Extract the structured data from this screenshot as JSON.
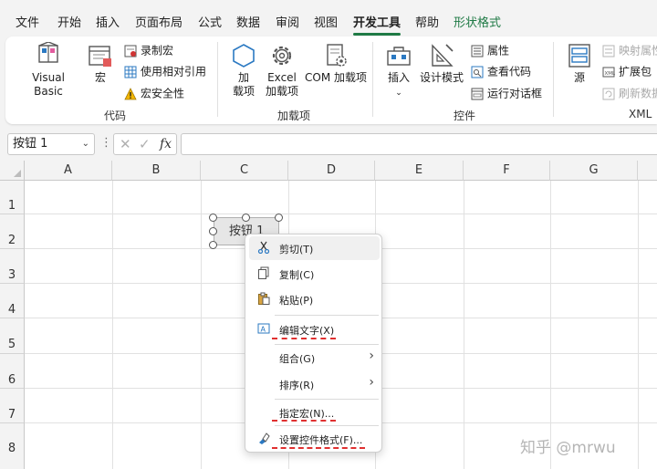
{
  "menubar": {
    "tabs": [
      "文件",
      "开始",
      "插入",
      "页面布局",
      "公式",
      "数据",
      "审阅",
      "视图",
      "开发工具",
      "帮助",
      "形状格式"
    ]
  },
  "ribbon": {
    "code": {
      "label": "代码",
      "visual_basic": "Visual Basic",
      "macros": "宏",
      "record_macro": "录制宏",
      "relative_ref": "使用相对引用",
      "macro_security": "宏安全性"
    },
    "addins": {
      "label": "加载项",
      "addins_line1": "加",
      "addins_line2": "载项",
      "excel_line1": "Excel",
      "excel_line2": "加载项",
      "com_addins": "COM 加载项"
    },
    "controls": {
      "label": "控件",
      "insert": "插入",
      "design_mode": "设计模式",
      "properties": "属性",
      "view_code": "查看代码",
      "run_dialog": "运行对话框"
    },
    "xml": {
      "label": "XML",
      "source": "源",
      "map_properties": "映射属性",
      "expansion_packs": "扩展包",
      "refresh_data": "刷新数据"
    }
  },
  "formula_bar": {
    "name_box": "按钮 1",
    "cancel_symbol": "✕",
    "enter_symbol": "✓",
    "fx_symbol": "fx",
    "content": ""
  },
  "grid": {
    "columns": [
      "A",
      "B",
      "C",
      "D",
      "E",
      "F",
      "G"
    ],
    "rows": [
      "1",
      "2",
      "3",
      "4",
      "5",
      "6",
      "7",
      "8"
    ]
  },
  "form_button": {
    "label": "按钮 1"
  },
  "context_menu": {
    "items": [
      {
        "label": "剪切(T)"
      },
      {
        "label": "复制(C)"
      },
      {
        "label": "粘贴(P)"
      },
      {
        "label": "编辑文字(X)"
      },
      {
        "label": "组合(G)"
      },
      {
        "label": "排序(R)"
      },
      {
        "label": "指定宏(N)..."
      },
      {
        "label": "设置控件格式(F)..."
      }
    ]
  },
  "watermark": "知乎 @mrwu",
  "colors": {
    "accent": "#1f7a45",
    "annotation": "#e03030"
  }
}
